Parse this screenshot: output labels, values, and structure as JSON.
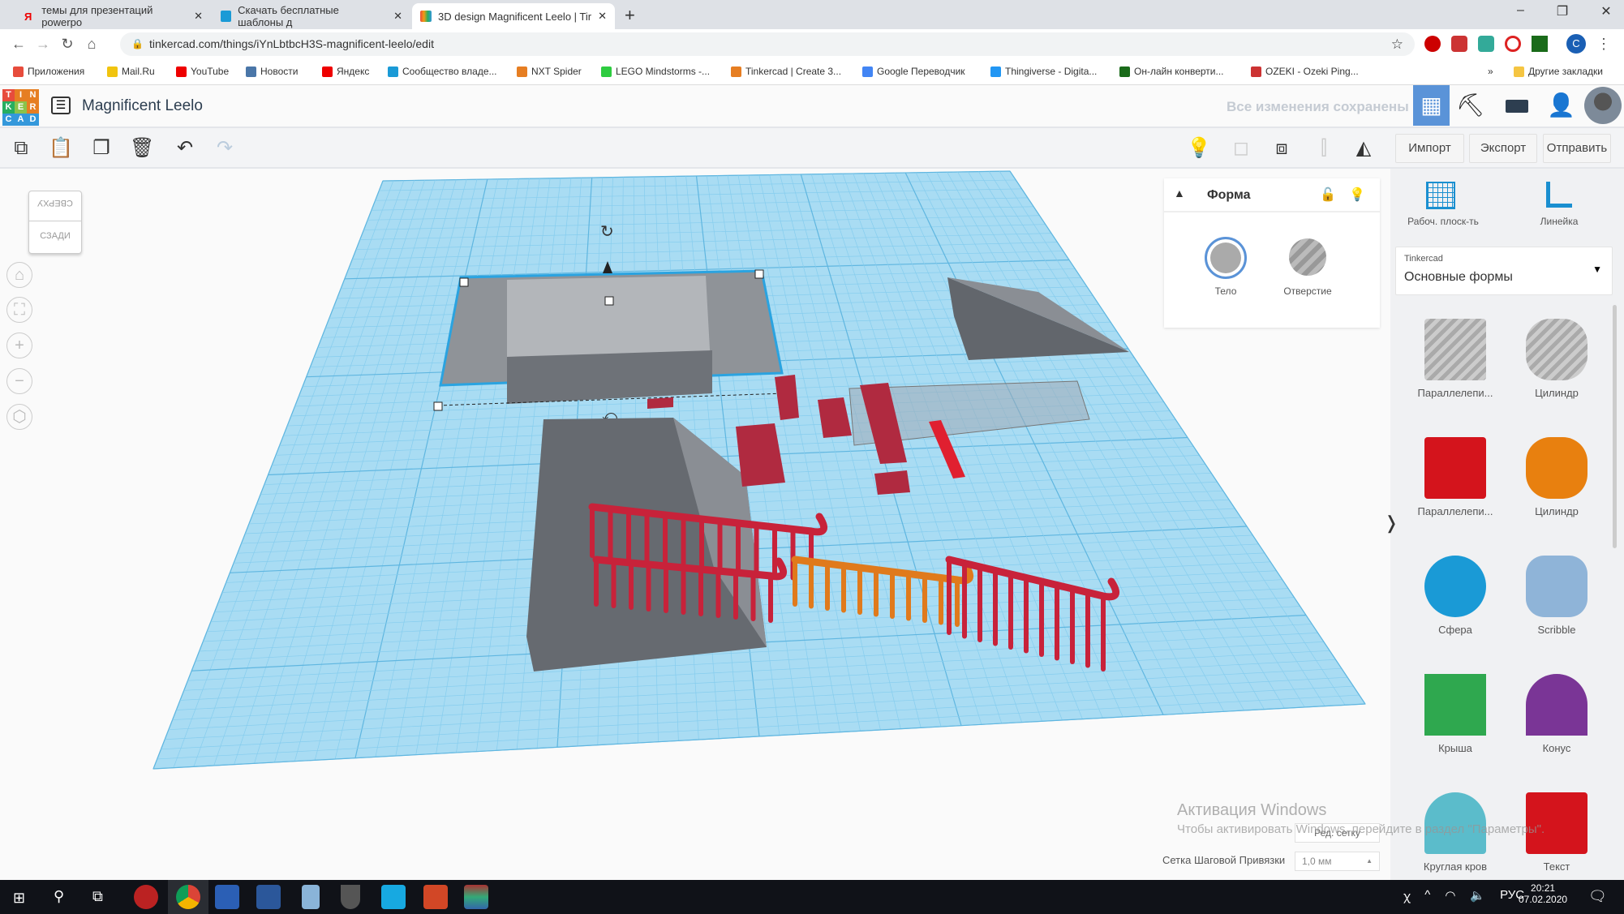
{
  "browser": {
    "tabs": [
      {
        "label": "темы для презентаций powerpo",
        "icon": "yandex-icon",
        "active": false
      },
      {
        "label": "Скачать бесплатные шаблоны д",
        "icon": "slides-icon",
        "active": false
      },
      {
        "label": "3D design Magnificent Leelo | Tir",
        "icon": "tinkercad-icon",
        "active": true
      }
    ],
    "url": "tinkercad.com/things/iYnLbtbcH3S-magnificent-leelo/edit",
    "bookmarks": [
      "Приложения",
      "Mail.Ru",
      "YouTube",
      "Новости",
      "Яндекс",
      "Сообщество владе...",
      "NXT Spider",
      "LEGO Mindstorms -...",
      "Tinkercad | Create 3...",
      "Google Переводчик",
      "Thingiverse - Digita...",
      "Он-лайн конверти...",
      "OZEKI - Ozeki Ping..."
    ],
    "other_bookmarks": "Другие закладки",
    "profile_initial": "C"
  },
  "app": {
    "logo": "TINKERCAD",
    "design_title": "Magnificent Leelo",
    "save_status": "Все изменения сохранены",
    "actions": {
      "import": "Импорт",
      "export": "Экспорт",
      "send": "Отправить"
    },
    "viewcube": {
      "top": "СВЕРХУ",
      "back": "СЗАДИ"
    }
  },
  "shape_panel": {
    "title": "Форма",
    "solid": "Тело",
    "hole": "Отверстие"
  },
  "sidebar": {
    "workplane": "Рабоч. плоск-ть",
    "ruler": "Линейка",
    "library_source": "Tinkercad",
    "library": "Основные формы",
    "shapes": [
      {
        "label": "Параллелепи...",
        "color": "#b8bcc2"
      },
      {
        "label": "Цилиндр",
        "color": "#c5c8cc"
      },
      {
        "label": "Параллелепи...",
        "color": "#d4141c"
      },
      {
        "label": "Цилиндр",
        "color": "#e8800f"
      },
      {
        "label": "Сфера",
        "color": "#1a9ad6"
      },
      {
        "label": "Scribble",
        "color": "#8fb4d8"
      },
      {
        "label": "Крыша",
        "color": "#2fa84f"
      },
      {
        "label": "Конус",
        "color": "#7a3596"
      },
      {
        "label": "Круглая кров",
        "color": "#5bbccb"
      },
      {
        "label": "Текст",
        "color": "#d4141c"
      }
    ]
  },
  "bottom": {
    "edit_grid": "Ред. сетку",
    "snap_label": "Сетка Шаговой Привязки",
    "snap_value": "1,0 мм"
  },
  "watermark": {
    "title": "Активация Windows",
    "text": "Чтобы активировать Windows, перейдите в раздел \"Параметры\"."
  },
  "taskbar": {
    "lang": "РУС",
    "time": "20:21",
    "date": "07.02.2020"
  },
  "colors": {
    "accent": "#5a93d8",
    "grid": "#8fd0ee",
    "railing": "#c8223a",
    "railing_alt": "#e07a1c",
    "solid": "#6b6f75"
  }
}
